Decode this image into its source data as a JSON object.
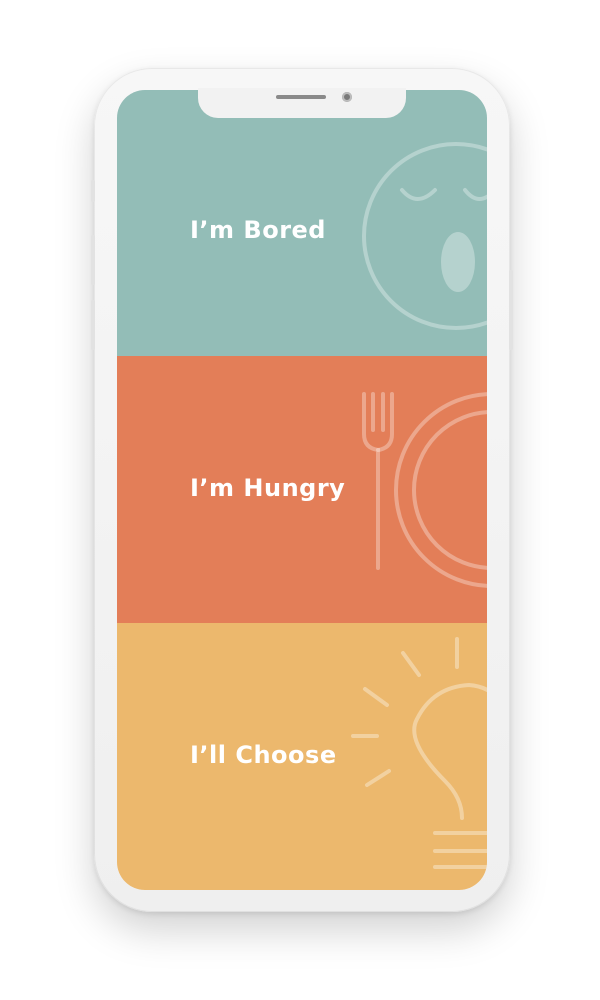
{
  "colors": {
    "bored": "#93bdb7",
    "hungry": "#e37e58",
    "choose": "#ecb86d",
    "device_frame": "#f4f4f4"
  },
  "options": [
    {
      "label": "I’m Bored",
      "icon": "sleepy-face-icon"
    },
    {
      "label": "I’m Hungry",
      "icon": "fork-and-plate-icon"
    },
    {
      "label": "I’ll Choose",
      "icon": "light-bulb-icon"
    }
  ]
}
